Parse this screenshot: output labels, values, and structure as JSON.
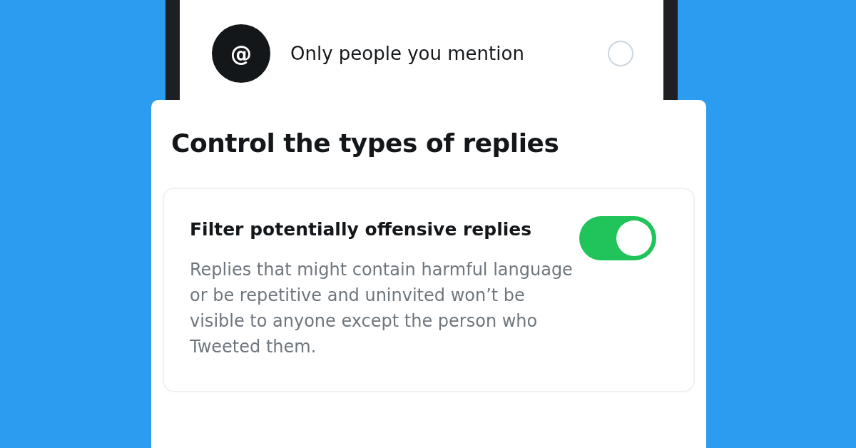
{
  "audience_option": {
    "icon_text": "@",
    "label": "Only people you mention",
    "selected": false
  },
  "card": {
    "title": "Control the types of replies",
    "setting": {
      "label": "Filter potentially offensive replies",
      "on": true,
      "description": "Replies that might contain harmful language or be repetitive and uninvited won’t be visible to anyone except the person who Tweeted them."
    }
  }
}
